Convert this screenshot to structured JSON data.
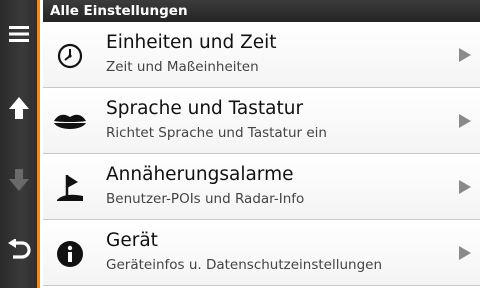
{
  "header": {
    "title": "Alle Einstellungen"
  },
  "sidebar": {
    "buttons": [
      {
        "icon": "menu-icon",
        "enabled": true
      },
      {
        "icon": "arrow-up-icon",
        "enabled": true
      },
      {
        "icon": "arrow-down-icon",
        "enabled": false
      },
      {
        "icon": "back-icon",
        "enabled": true
      }
    ]
  },
  "items": [
    {
      "title": "Einheiten und Zeit",
      "subtitle": "Zeit und Maßeinheiten",
      "icon": "clock-icon"
    },
    {
      "title": "Sprache und Tastatur",
      "subtitle": "Richtet Sprache und Tastatur ein",
      "icon": "lips-icon"
    },
    {
      "title": "Annäherungsalarme",
      "subtitle": "Benutzer-POIs und Radar-Info",
      "icon": "alarm-flag-icon"
    },
    {
      "title": "Gerät",
      "subtitle": "Geräteinfos u. Datenschutzeinstellungen",
      "icon": "info-icon"
    }
  ],
  "colors": {
    "accent": "#f08a1c",
    "sidebar": "#333333",
    "arrow": "#8a8a8a"
  }
}
